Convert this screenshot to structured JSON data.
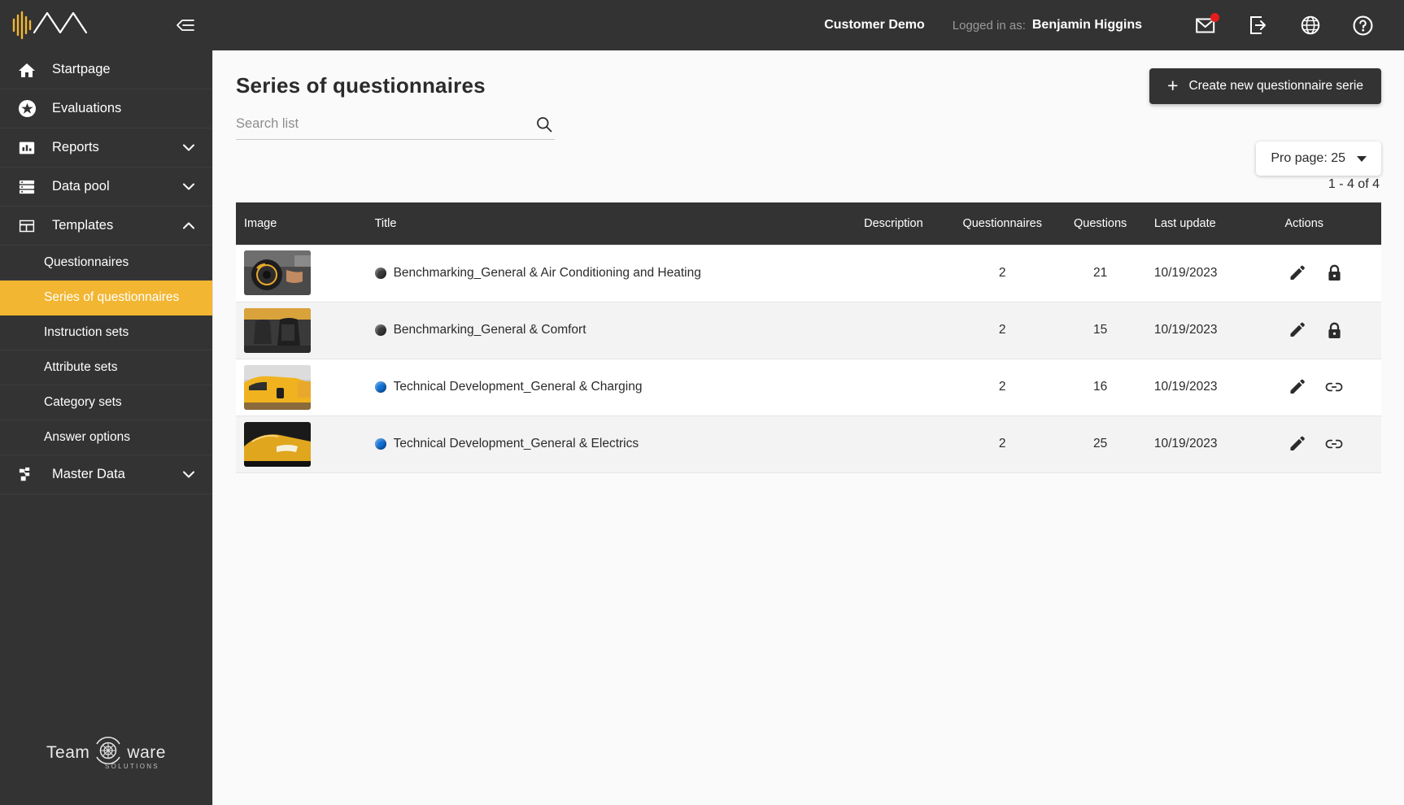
{
  "sidebar": {
    "logo_alt": "brand-logo",
    "collapse_icon": "collapse-sidebar-icon",
    "items": [
      {
        "label": "Startpage",
        "icon": "home-icon",
        "expandable": false,
        "expanded": false
      },
      {
        "label": "Evaluations",
        "icon": "star-icon",
        "expandable": false,
        "expanded": false
      },
      {
        "label": "Reports",
        "icon": "bar-chart-icon",
        "expandable": true,
        "expanded": false
      },
      {
        "label": "Data pool",
        "icon": "database-icon",
        "expandable": true,
        "expanded": false
      },
      {
        "label": "Templates",
        "icon": "layout-icon",
        "expandable": true,
        "expanded": true
      },
      {
        "label": "Master Data",
        "icon": "hierarchy-icon",
        "expandable": true,
        "expanded": false
      }
    ],
    "templates_children": [
      {
        "label": "Questionnaires",
        "active": false
      },
      {
        "label": "Series of questionnaires",
        "active": true
      },
      {
        "label": "Instruction sets",
        "active": false
      },
      {
        "label": "Attribute sets",
        "active": false
      },
      {
        "label": "Category sets",
        "active": false
      },
      {
        "label": "Answer options",
        "active": false
      }
    ],
    "footer_logo": {
      "word_left": "Team",
      "word_right": "ware",
      "subtitle": "SOLUTIONS"
    },
    "active_color": "#F2B632",
    "background": "#333333"
  },
  "header": {
    "customer": "Customer Demo",
    "logged_in_label": "Logged in as:",
    "user_name": "Benjamin Higgins",
    "icons": [
      {
        "name": "mail-icon",
        "badge": true
      },
      {
        "name": "logout-icon",
        "badge": false
      },
      {
        "name": "globe-icon",
        "badge": false
      },
      {
        "name": "help-icon",
        "badge": false
      }
    ],
    "badge_color": "#e51d1d"
  },
  "page": {
    "title": "Series of questionnaires",
    "create_button": {
      "label": "Create new questionnaire serie",
      "icon": "plus-icon"
    },
    "search": {
      "placeholder": "Search list",
      "value": "",
      "icon": "search-icon"
    },
    "per_page": {
      "label": "Pro page: 25",
      "icon": "chevron-down-icon"
    },
    "result_count": "1 - 4 of 4"
  },
  "table": {
    "columns": [
      "Image",
      "Title",
      "Description",
      "Questionnaires",
      "Questions",
      "Last update",
      "Actions"
    ],
    "rows": [
      {
        "title": "Benchmarking_General & Air Conditioning and Heating",
        "dot_color": "#3a3a3a",
        "description": "",
        "questionnaires": "2",
        "questions": "21",
        "last_update": "10/19/2023",
        "actions": [
          "edit-icon",
          "lock-icon"
        ],
        "thumb": "steering-wheel-controls-photo"
      },
      {
        "title": "Benchmarking_General & Comfort",
        "dot_color": "#3a3a3a",
        "description": "",
        "questionnaires": "2",
        "questions": "15",
        "last_update": "10/19/2023",
        "actions": [
          "edit-icon",
          "lock-icon"
        ],
        "thumb": "car-seats-photo"
      },
      {
        "title": "Technical Development_General & Charging",
        "dot_color": "#1171d6",
        "description": "",
        "questionnaires": "2",
        "questions": "16",
        "last_update": "10/19/2023",
        "actions": [
          "edit-icon",
          "link-icon"
        ],
        "thumb": "yellow-car-charging-photo"
      },
      {
        "title": "Technical Development_General & Electrics",
        "dot_color": "#1171d6",
        "description": "",
        "questionnaires": "2",
        "questions": "25",
        "last_update": "10/19/2023",
        "actions": [
          "edit-icon",
          "link-icon"
        ],
        "thumb": "yellow-car-headlight-photo"
      }
    ]
  }
}
